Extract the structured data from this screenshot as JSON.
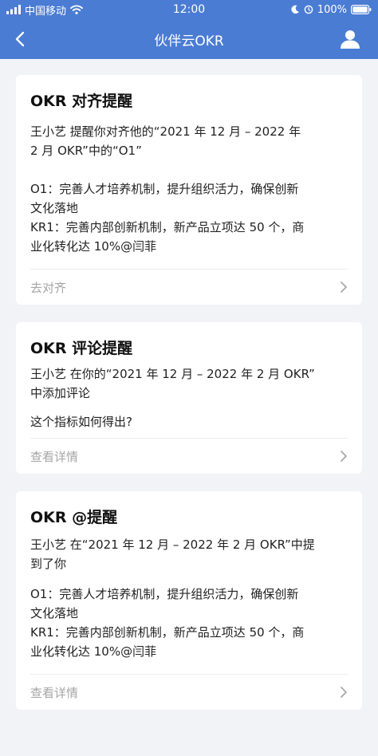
{
  "status": {
    "carrier": "中国移动",
    "time": "12:00",
    "battery": "100%"
  },
  "nav": {
    "title": "伙伴云OKR"
  },
  "cards": [
    {
      "title": "OKR 对齐提醒",
      "lines": [
        "王小艺 提醒你对齐他的“2021 年 12 月 – 2022 年",
        "2 月 OKR”中的“O1”",
        "O1：完善人才培养机制，提升组织活力，确保创新",
        "文化落地",
        "KR1：完善内部创新机制，新产品立项达 50 个，商",
        "业化转化达 10%@闫菲"
      ],
      "footer": "去对齐"
    },
    {
      "title": "OKR 评论提醒",
      "lines": [
        "王小艺 在你的“2021 年 12 月 – 2022 年 2 月 OKR”",
        "中添加评论",
        "这个指标如何得出?"
      ],
      "footer": "查看详情"
    },
    {
      "title": "OKR @提醒",
      "lines": [
        "王小艺 在“2021 年 12 月 – 2022 年 2 月 OKR”中提",
        "到了你",
        "O1：完善人才培养机制，提升组织活力，确保创新",
        "文化落地",
        "KR1：完善内部创新机制，新产品立项达 50 个，商",
        "业化转化达 10%@闫菲"
      ],
      "footer": "查看详情"
    }
  ],
  "icons": {
    "signal": "signal-icon",
    "wifi": "wifi-icon",
    "moon": "moon-icon",
    "battery": "battery-icon",
    "back": "chevron-left-icon",
    "user": "user-icon",
    "chevron": "chevron-right-icon"
  },
  "colors": {
    "header": "#4a7cd4",
    "background": "#f2f3f6",
    "card": "#ffffff",
    "muted": "#a5a5a5"
  }
}
